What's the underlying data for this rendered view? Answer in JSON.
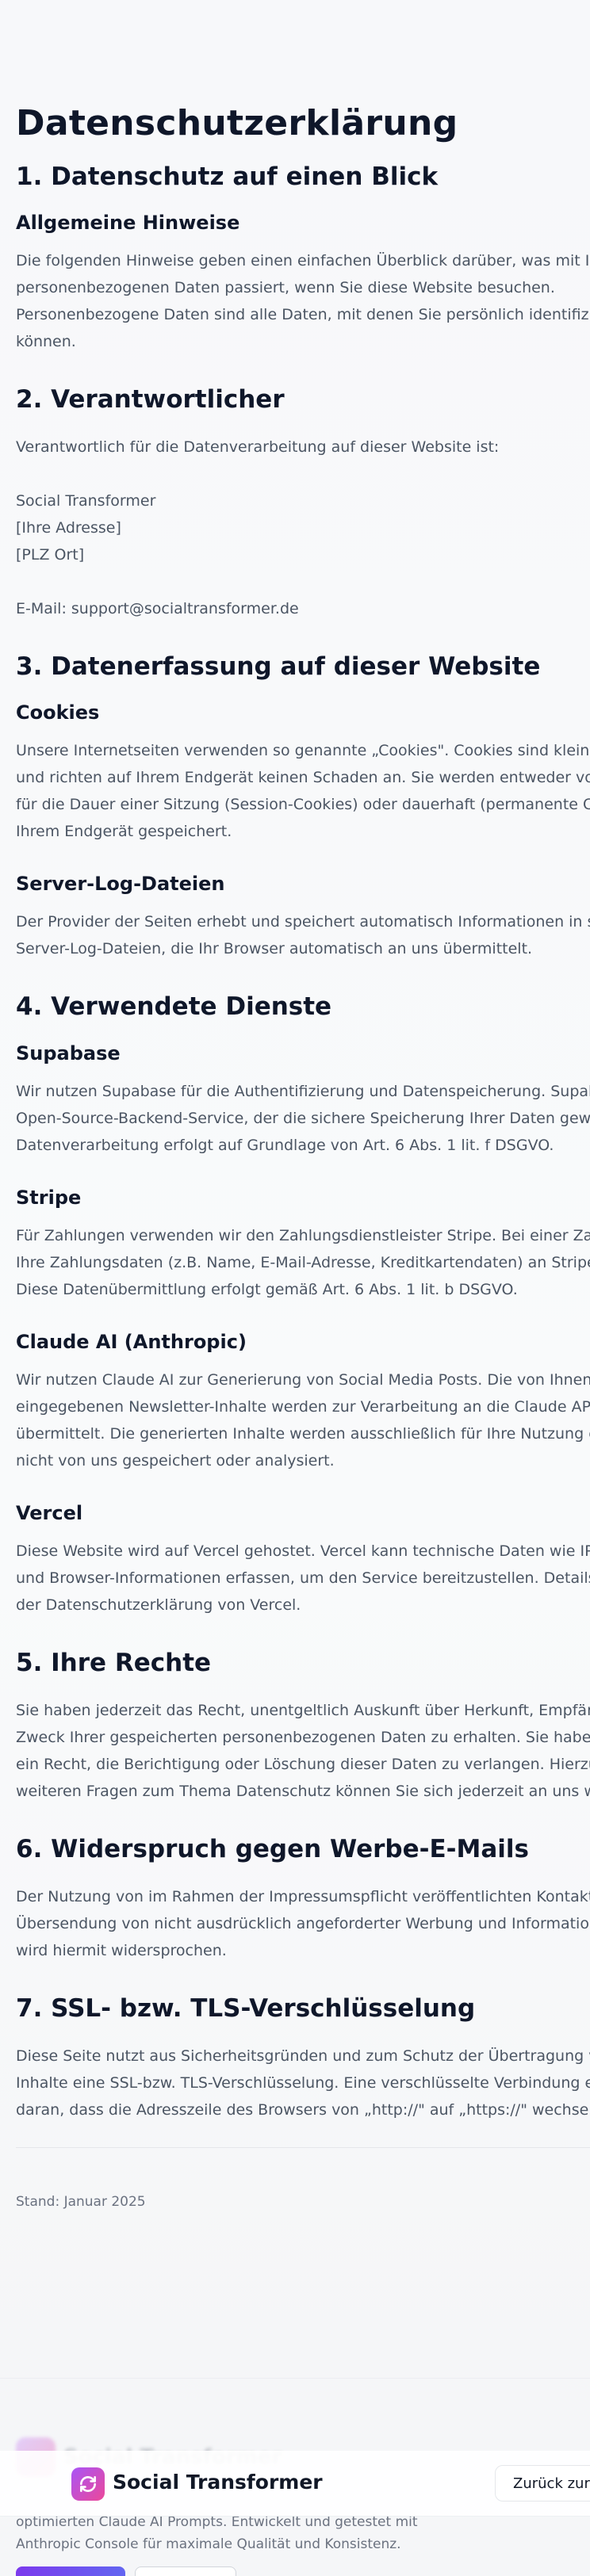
{
  "page_title": "Datenschutzerklärung",
  "sections": {
    "s1": {
      "title": "1. Datenschutz auf einen Blick",
      "h_general": "Allgemeine Hinweise",
      "general_lines": [
        "Die folgenden Hinweise geben einen einfachen Überblick darüber, was mit Ihren",
        "personenbezogenen Daten passiert, wenn Sie diese Website besuchen.",
        "Personenbezogene Daten sind alle Daten, mit denen Sie persönlich identifiziert werden",
        "können."
      ]
    },
    "s2": {
      "title": "2. Verantwortlicher",
      "intro": "Verantwortlich für die Datenverarbeitung auf dieser Website ist:",
      "company": "Social Transformer",
      "address": "[Ihre Adresse]",
      "city": "[PLZ Ort]",
      "email": "E-Mail: support@socialtransformer.de"
    },
    "s3": {
      "title": "3. Datenerfassung auf dieser Website",
      "h_cookies": "Cookies",
      "cookies_lines": [
        "Unsere Internetseiten verwenden so genannte „Cookies\". Cookies sind kleine Textdateien",
        "und richten auf Ihrem Endgerät keinen Schaden an. Sie werden entweder vorübergehend",
        "für die Dauer einer Sitzung (Session-Cookies) oder dauerhaft (permanente Cookies) auf",
        "Ihrem Endgerät gespeichert."
      ],
      "h_logs": "Server-Log-Dateien",
      "logs_lines": [
        "Der Provider der Seiten erhebt und speichert automatisch Informationen in so genannten",
        "Server-Log-Dateien, die Ihr Browser automatisch an uns übermittelt."
      ]
    },
    "s4": {
      "title": "4. Verwendete Dienste",
      "h_supabase": "Supabase",
      "supabase_lines": [
        "Wir nutzen Supabase für die Authentifizierung und Datenspeicherung. Supabase ist ein",
        "Open-Source-Backend-Service, der die sichere Speicherung Ihrer Daten gewährleistet. Die",
        "Datenverarbeitung erfolgt auf Grundlage von Art. 6 Abs. 1 lit. f DSGVO."
      ],
      "h_stripe": "Stripe",
      "stripe_lines": [
        "Für Zahlungen verwenden wir den Zahlungsdienstleister Stripe. Bei einer Zahlung werden",
        "Ihre Zahlungsdaten (z.B. Name, E-Mail-Adresse, Kreditkartendaten) an Stripe übermittelt.",
        "Diese Datenübermittlung erfolgt gemäß Art. 6 Abs. 1 lit. b DSGVO."
      ],
      "h_claude": "Claude AI (Anthropic)",
      "claude_lines": [
        "Wir nutzen Claude AI zur Generierung von Social Media Posts. Die von Ihnen",
        "eingegebenen Newsletter-Inhalte werden zur Verarbeitung an die Claude API von Anthropic",
        "übermittelt. Die generierten Inhalte werden ausschließlich für Ihre Nutzung erstellt und",
        "nicht von uns gespeichert oder analysiert."
      ],
      "h_vercel": "Vercel",
      "vercel_lines": [
        "Diese Website wird auf Vercel gehostet. Vercel kann technische Daten wie IP-Adressen",
        "und Browser-Informationen erfassen, um den Service bereitzustellen. Details finden Sie in",
        "der Datenschutzerklärung von Vercel."
      ]
    },
    "s5": {
      "title": "5. Ihre Rechte",
      "lines": [
        "Sie haben jederzeit das Recht, unentgeltlich Auskunft über Herkunft, Empfänger und",
        "Zweck Ihrer gespeicherten personenbezogenen Daten zu erhalten. Sie haben außerdem",
        "ein Recht, die Berichtigung oder Löschung dieser Daten zu verlangen. Hierzu sowie zu",
        "weiteren Fragen zum Thema Datenschutz können Sie sich jederzeit an uns wenden."
      ]
    },
    "s6": {
      "title": "6. Widerspruch gegen Werbe-E-Mails",
      "lines": [
        "Der Nutzung von im Rahmen der Impressumspflicht veröffentlichten Kontaktdaten zur",
        "Übersendung von nicht ausdrücklich angeforderter Werbung und Informationsmaterialien",
        "wird hiermit widersprochen."
      ]
    },
    "s7": {
      "title": "7. SSL- bzw. TLS-Verschlüsselung",
      "lines": [
        "Diese Seite nutzt aus Sicherheitsgründen und zum Schutz der Übertragung vertraulicher",
        "Inhalte eine SSL-bzw. TLS-Verschlüsselung. Eine verschlüsselte Verbindung erkennen Sie",
        "daran, dass die Adresszeile des Browsers von „http://\" auf „https://\" wechselt."
      ]
    }
  },
  "stand": "Stand: Januar 2025",
  "footer": {
    "brand": "Social Transformer",
    "desc_lines": [
      "optimierten Claude AI Prompts. Entwickelt und getestet mit",
      "Anthropic Console für maximale Qualität und Konsistenz."
    ]
  },
  "header": {
    "brand": "Social Transformer",
    "back_label": "Zurück zur Startseite"
  },
  "colors": {
    "accent_gradient_start": "#a855f7",
    "accent_gradient_end": "#ec4899",
    "heading": "#0f172a",
    "body_text": "#4b5563"
  }
}
